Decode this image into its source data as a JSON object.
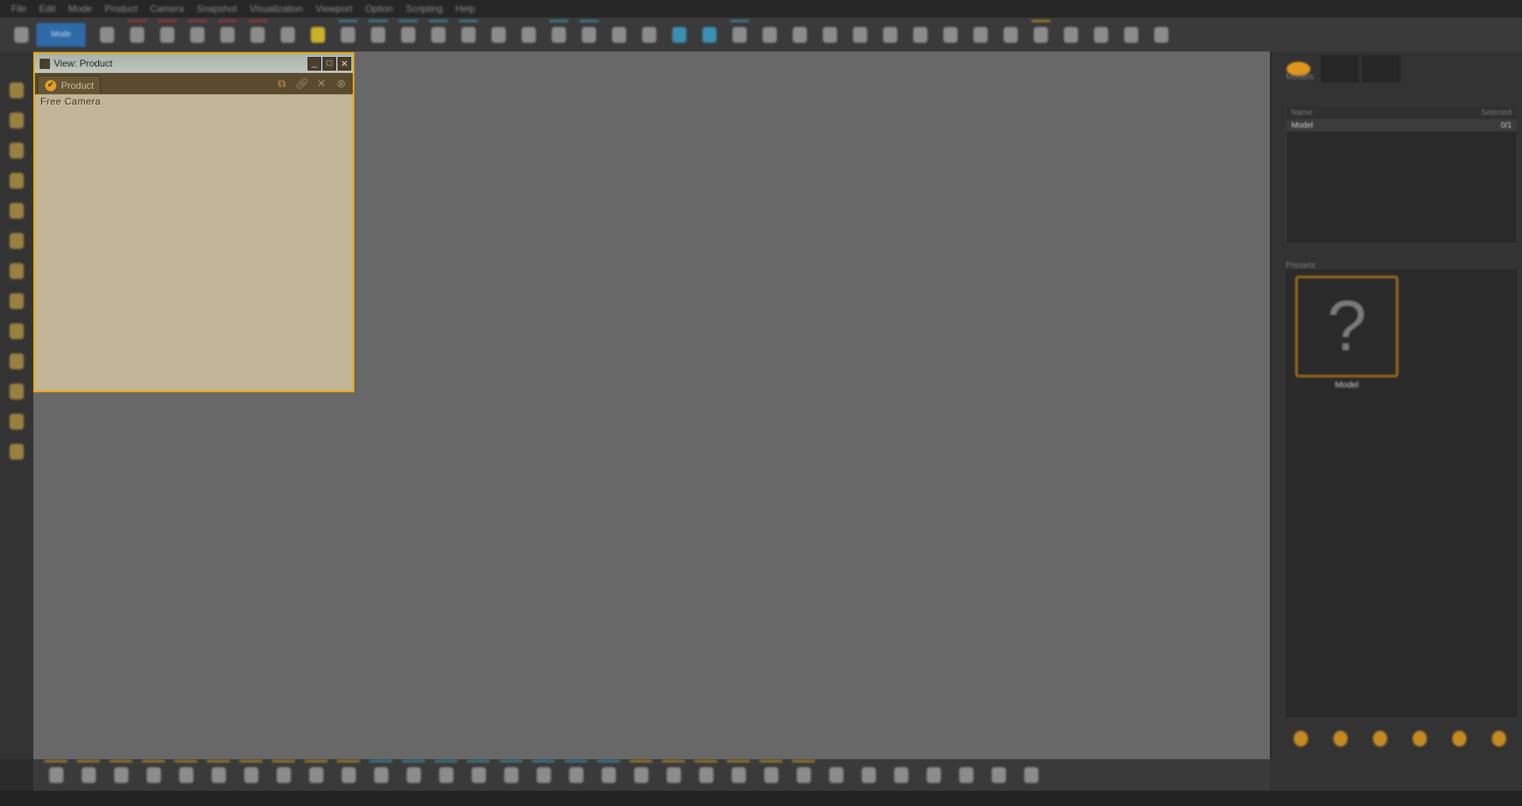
{
  "menu": [
    "File",
    "Edit",
    "Mode",
    "Product",
    "Camera",
    "Snapshot",
    "Visualization",
    "Viewport",
    "Option",
    "Scripting",
    "Help"
  ],
  "toolbar": {
    "mode_label": "Mode",
    "icons": [
      {
        "n": "pointer-icon",
        "c": ""
      },
      {
        "n": "new-file-icon",
        "c": "red"
      },
      {
        "n": "open-folder-icon",
        "c": "red"
      },
      {
        "n": "save-icon",
        "c": "red"
      },
      {
        "n": "link-icon",
        "c": "red"
      },
      {
        "n": "undo-icon",
        "c": "red"
      },
      {
        "n": "redo-icon",
        "c": ""
      },
      {
        "n": "select-icon",
        "c": "yellow"
      },
      {
        "n": "hand-icon",
        "c": "blue"
      },
      {
        "n": "orbit-icon",
        "c": "blue"
      },
      {
        "n": "zoom-icon",
        "c": "blue"
      },
      {
        "n": "camera-icon",
        "c": "blue"
      },
      {
        "n": "fly-icon",
        "c": "blue"
      },
      {
        "n": "plane-icon",
        "c": ""
      },
      {
        "n": "walk-icon",
        "c": ""
      },
      {
        "n": "tripod-icon",
        "c": "blue"
      },
      {
        "n": "move-icon",
        "c": "blue"
      },
      {
        "n": "rotate-icon",
        "c": ""
      },
      {
        "n": "scale-icon",
        "c": ""
      },
      {
        "n": "snap-a-icon",
        "c": "cyan"
      },
      {
        "n": "snap-b-icon",
        "c": "cyan"
      },
      {
        "n": "measure-icon",
        "c": "blue"
      },
      {
        "n": "ruler-icon",
        "c": ""
      },
      {
        "n": "target-icon",
        "c": ""
      },
      {
        "n": "pivot-icon",
        "c": ""
      },
      {
        "n": "field-icon",
        "c": ""
      },
      {
        "n": "globe-a-icon",
        "c": ""
      },
      {
        "n": "globe-b-icon",
        "c": ""
      },
      {
        "n": "grid-a-icon",
        "c": ""
      },
      {
        "n": "grid-b-icon",
        "c": ""
      },
      {
        "n": "grid-c-icon",
        "c": ""
      },
      {
        "n": "free-icon",
        "c": "gold"
      },
      {
        "n": "clock-icon",
        "c": ""
      },
      {
        "n": "settings-icon",
        "c": ""
      },
      {
        "n": "refresh-icon",
        "c": ""
      },
      {
        "n": "info-icon",
        "c": ""
      }
    ]
  },
  "left_toolbar": [
    "scene-icon",
    "light-icon",
    "environment-icon",
    "material-icon",
    "render-icon",
    "lamp-icon",
    "animation-icon",
    "vr-icon",
    "sphere-icon",
    "image-icon",
    "photo-icon",
    "chart-icon",
    "free-icon"
  ],
  "view_window": {
    "title": "View: Product",
    "tab": "Product",
    "camera": "Free Camera",
    "min": "_",
    "max": "□",
    "close": "✕"
  },
  "right_panel": {
    "models_label": "Models",
    "columns": [
      "Name",
      "Selected"
    ],
    "rows": [
      {
        "name": "Model",
        "selected": "0/1"
      }
    ],
    "presets_label": "Presets",
    "preset_name": "Model",
    "thumb_glyph": "?",
    "bottom_icons": [
      "add-icon",
      "add-multiple-icon",
      "check-icon",
      "view-icon",
      "delete-icon",
      "close-icon"
    ]
  },
  "bottom_toolbar": [
    "terrain-icon",
    "road-icon",
    "texture-a-icon",
    "texture-b-icon",
    "cloud-icon",
    "sun-icon",
    "building-icon",
    "tree-icon",
    "figure-icon",
    "compass-icon",
    "bulb-icon",
    "spot-icon",
    "pin-icon",
    "camera-a-icon",
    "video-icon",
    "lens-icon",
    "light-beam-icon",
    "rain-icon",
    "contrast-icon",
    "clip-icon",
    "headphones-icon",
    "timer-icon",
    "gauge-icon",
    "monitor-icon",
    "keyboard-icon",
    "pen-icon",
    "vector-icon",
    "ruler-icon",
    "paint-icon",
    "speaker-icon",
    "axes-icon"
  ],
  "colors": {
    "accent": "#f0a800",
    "viewport": "#686868",
    "view_bg": "#c2b496",
    "mode_blue": "#2f6aa8"
  }
}
